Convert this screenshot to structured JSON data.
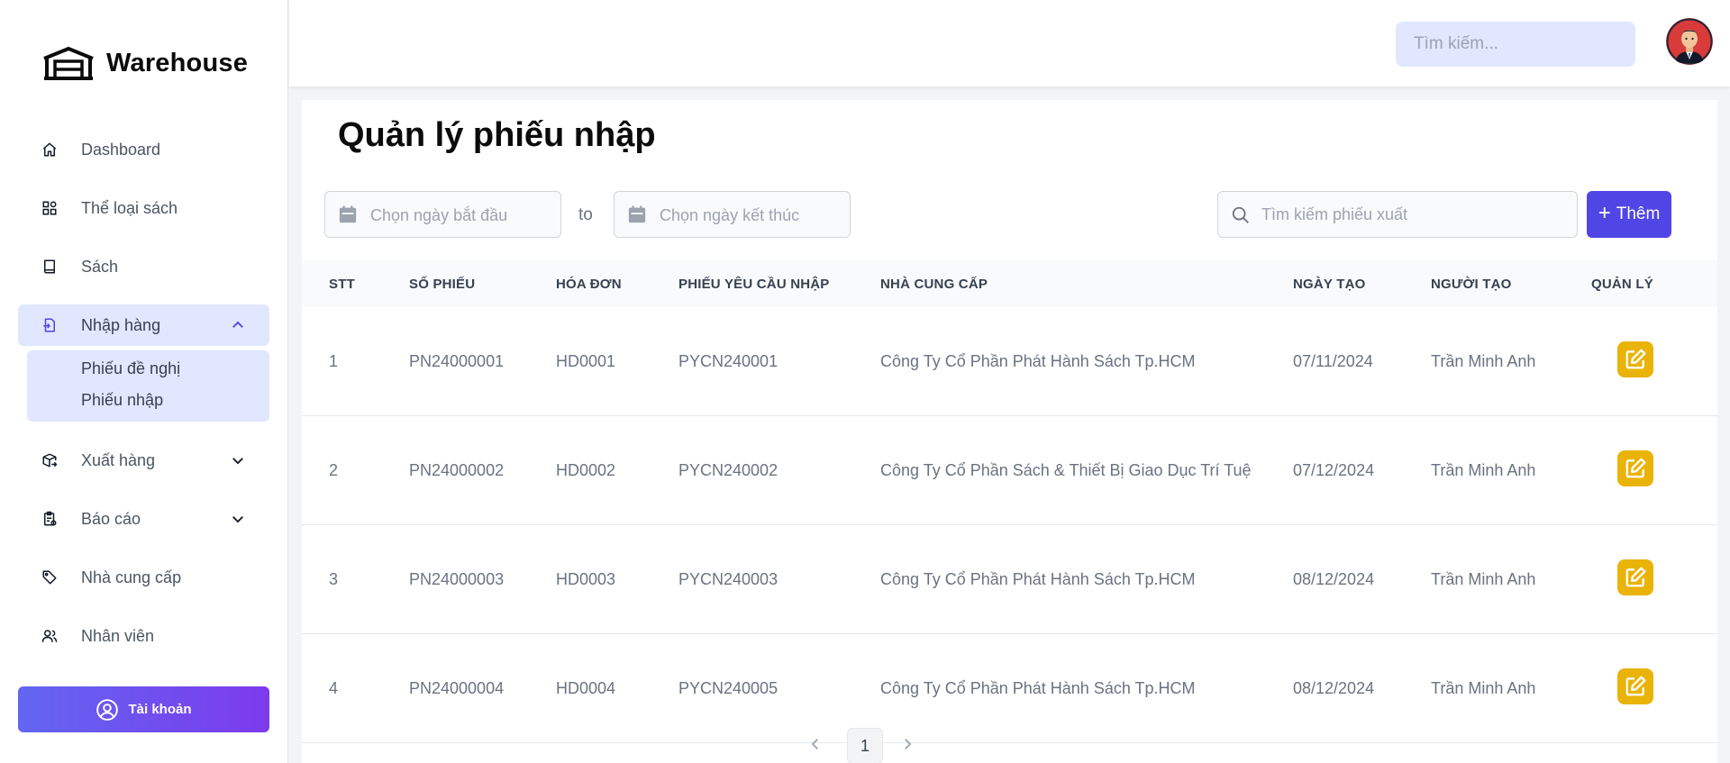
{
  "app": {
    "name": "Warehouse"
  },
  "sidebar": {
    "items": [
      {
        "label": "Dashboard",
        "icon": "home-icon"
      },
      {
        "label": "Thể loại sách",
        "icon": "grid-icon"
      },
      {
        "label": "Sách",
        "icon": "book-icon"
      },
      {
        "label": "Nhập hàng",
        "icon": "import-icon",
        "expanded": true
      },
      {
        "label": "Xuất hàng",
        "icon": "export-box-icon",
        "expanded": false
      },
      {
        "label": "Báo cáo",
        "icon": "report-icon",
        "expanded": false
      },
      {
        "label": "Nhà cung cấp",
        "icon": "tag-icon"
      },
      {
        "label": "Nhân viên",
        "icon": "users-icon"
      }
    ],
    "submenu": [
      {
        "label": "Phiếu đề nghị"
      },
      {
        "label": "Phiếu nhập"
      }
    ],
    "account_label": "Tài khoản"
  },
  "header": {
    "search_placeholder": "Tìm kiếm..."
  },
  "main": {
    "title": "Quản lý phiếu nhập",
    "start_date_placeholder": "Chọn ngày bắt đầu",
    "to_label": "to",
    "end_date_placeholder": "Chọn ngày kết thúc",
    "search_placeholder": "Tìm kiếm phiếu xuất",
    "add_label": "Thêm",
    "columns": [
      "STT",
      "Số phiếu",
      "Hóa đơn",
      "Phiếu yêu cầu nhập",
      "Nhà cung cấp",
      "Ngày tạo",
      "Người tạo",
      "Quản lý"
    ],
    "rows": [
      {
        "stt": "1",
        "so_phieu": "PN24000001",
        "hoa_don": "HD0001",
        "phieu_yc": "PYCN240001",
        "nha_cc": "Công Ty Cổ Phần Phát Hành Sách Tp.HCM",
        "ngay_tao": "07/11/2024",
        "nguoi_tao": "Trần Minh Anh"
      },
      {
        "stt": "2",
        "so_phieu": "PN24000002",
        "hoa_don": "HD0002",
        "phieu_yc": "PYCN240002",
        "nha_cc": "Công Ty Cổ Phần Sách & Thiết Bị Giao Dục Trí Tuệ",
        "ngay_tao": "07/12/2024",
        "nguoi_tao": "Trần Minh Anh"
      },
      {
        "stt": "3",
        "so_phieu": "PN24000003",
        "hoa_don": "HD0003",
        "phieu_yc": "PYCN240003",
        "nha_cc": "Công Ty Cổ Phần Phát Hành Sách Tp.HCM",
        "ngay_tao": "08/12/2024",
        "nguoi_tao": "Trần Minh Anh"
      },
      {
        "stt": "4",
        "so_phieu": "PN24000004",
        "hoa_don": "HD0004",
        "phieu_yc": "PYCN240005",
        "nha_cc": "Công Ty Cổ Phần Phát Hành Sách Tp.HCM",
        "ngay_tao": "08/12/2024",
        "nguoi_tao": "Trần Minh Anh"
      }
    ],
    "pagination": {
      "current_page": "1"
    }
  },
  "colors": {
    "primary": "#4f46e5",
    "active_bg": "#e0e7ff",
    "edit": "#eab308",
    "account_gradient_start": "#6366f1",
    "account_gradient_end": "#7c3aed"
  }
}
